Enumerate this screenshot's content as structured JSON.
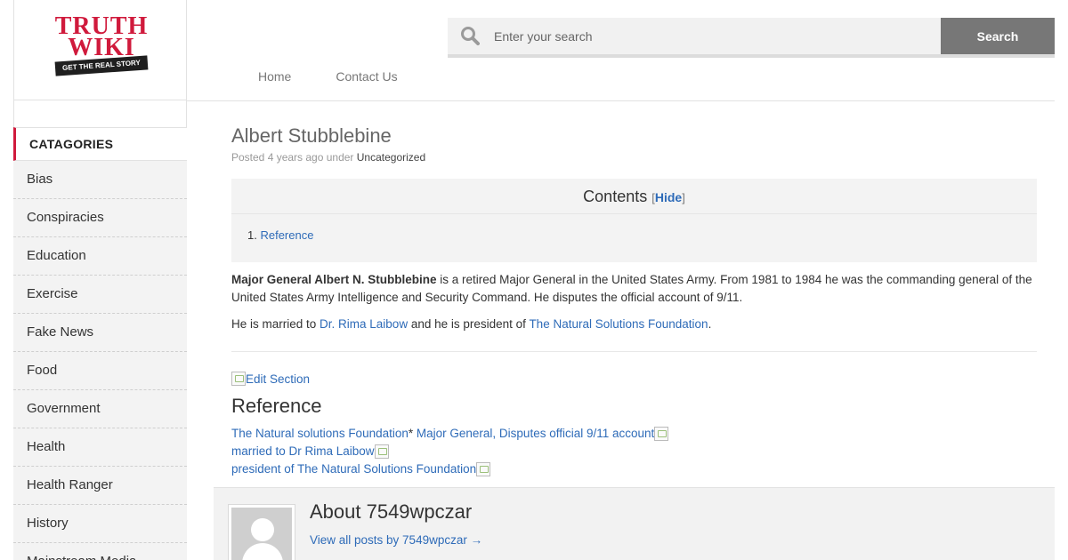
{
  "brand": {
    "word1": "TRUTH",
    "word2": "WIKI",
    "tagline": "GET THE REAL STORY",
    "accent": "#d01a3c"
  },
  "search": {
    "placeholder": "Enter your search",
    "button": "Search"
  },
  "nav": [
    {
      "label": "Home"
    },
    {
      "label": "Contact Us"
    }
  ],
  "sidebar": {
    "heading": "CATAGORIES",
    "items": [
      {
        "label": "Bias"
      },
      {
        "label": "Conspiracies"
      },
      {
        "label": "Education"
      },
      {
        "label": "Exercise"
      },
      {
        "label": "Fake News"
      },
      {
        "label": "Food"
      },
      {
        "label": "Government"
      },
      {
        "label": "Health"
      },
      {
        "label": "Health Ranger"
      },
      {
        "label": "History"
      },
      {
        "label": "Mainstream Media"
      }
    ]
  },
  "post": {
    "title": "Albert Stubblebine",
    "meta_prefix": "Posted 4 years ago under ",
    "category": "Uncategorized",
    "toc": {
      "heading": "Contents",
      "bracket_open": "[",
      "toggle": "Hide",
      "bracket_close": "]",
      "item_number": "1.",
      "item_label": "Reference"
    },
    "p1": {
      "bold": "Major General Albert N. Stubblebine",
      "rest": " is a retired Major General in the United States Army. From 1981 to 1984 he was the commanding general of the United States Army Intelligence and Security Command. He disputes the official account of 9/11."
    },
    "p2": {
      "before": "He is married to ",
      "link1": "Dr. Rima Laibow",
      "middle": " and he is president of ",
      "link2": "The Natural Solutions Foundation",
      "after": "."
    },
    "edit_section": "Edit Section",
    "reference_heading": "Reference",
    "refs": {
      "r1a": "The Natural solutions Foundation",
      "r1sep": "* ",
      "r1b": "Major General, Disputes official 9/11 account",
      "r2": "married to Dr Rima Laibow",
      "r3": "president of The Natural Solutions Foundation"
    }
  },
  "author": {
    "heading": "About 7549wpczar",
    "link": "View all posts by 7549wpczar →"
  }
}
